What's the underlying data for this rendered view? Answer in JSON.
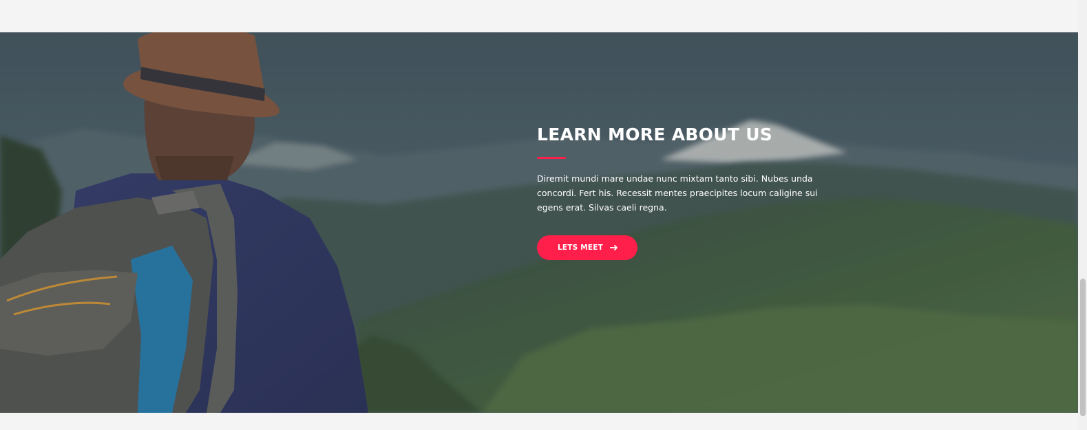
{
  "section": {
    "title": "LEARN MORE ABOUT US",
    "description": "Diremit mundi mare undae nunc mixtam tanto sibi. Nubes unda concordi. Fert his. Recessit mentes praecipites locum caligine sui egens erat. Silvas caeli regna.",
    "button_label": "LETS MEET",
    "button_icon": "arrow-right-icon"
  },
  "colors": {
    "accent": "#ff1f4a",
    "page_background": "#f4f4f4",
    "text": "#ffffff"
  }
}
